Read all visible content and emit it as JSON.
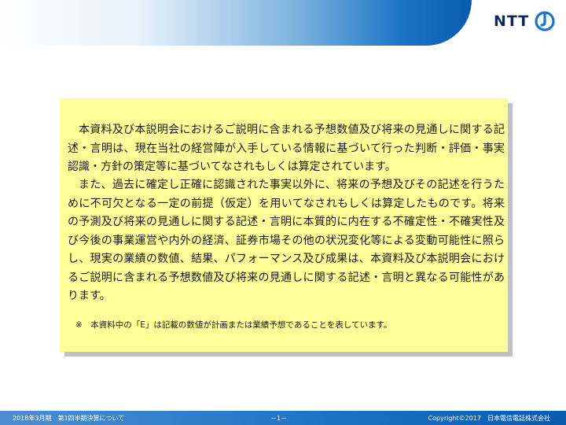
{
  "header": {
    "logo_text": "NTT",
    "logo_icon": "ntt-loop-icon",
    "brand_color": "#1c74c6"
  },
  "notice": {
    "paragraph_1": "本資料及び本説明会におけるご説明に含まれる予想数値及び将来の見通しに関する記述・言明は、現在当社の経営陣が入手している情報に基づいて行った判断・評価・事実認識・方針の策定等に基づいてなされもしくは算定されています。",
    "paragraph_2": "また、過去に確定し正確に認識された事実以外に、将来の予想及びその記述を行うために不可欠となる一定の前提（仮定）を用いてなされもしくは算定したものです。将来の予測及び将来の見通しに関する記述・言明に本質的に内在する不確定性・不確実性及び今後の事業運営や内外の経済、証券市場その他の状況変化等による変動可能性に照らし、現実の業績の数値、結果、パフォーマンス及び成果は、本資料及び本説明会におけるご説明に含まれる予想数値及び将来の見通しに関する記述・言明と異なる可能性があります。",
    "footnote": "※　本資料中の「E」は記載の数値が計画または業績予想であることを表しています。",
    "background_color": "#ffff99"
  },
  "footer": {
    "left": "2018年3月期　第1四半期決算について",
    "center": "－1－",
    "right": "Copyright©2017　日本電信電話株式会社"
  }
}
